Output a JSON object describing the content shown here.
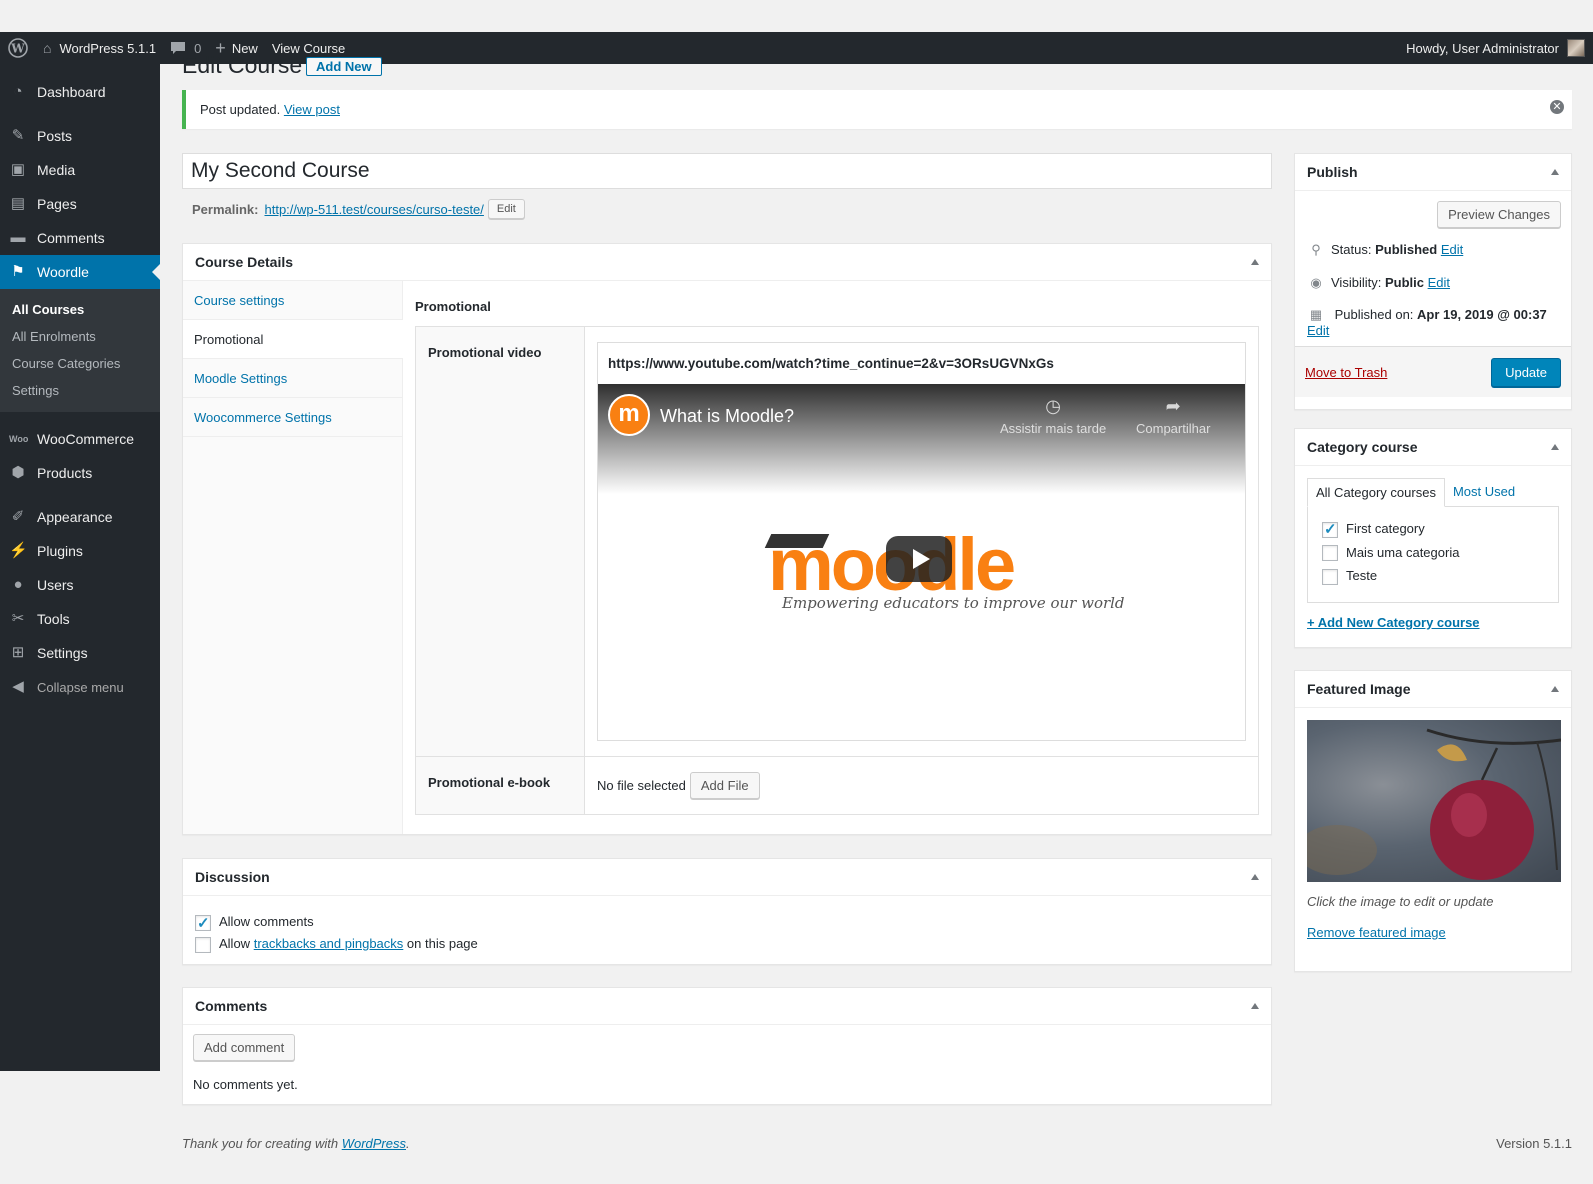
{
  "adminbar": {
    "site_name": "WordPress 5.1.1",
    "comments_count": "0",
    "new_label": "New",
    "view_label": "View Course",
    "howdy": "Howdy, User Administrator"
  },
  "sidebar": {
    "items": [
      {
        "label": "Dashboard",
        "icon": "dashboard-icon"
      },
      {
        "label": "Posts",
        "icon": "pin-icon"
      },
      {
        "label": "Media",
        "icon": "media-icon"
      },
      {
        "label": "Pages",
        "icon": "pages-icon"
      },
      {
        "label": "Comments",
        "icon": "comment-icon"
      },
      {
        "label": "Woordle",
        "icon": "graduation-cap-icon"
      }
    ],
    "submenu": [
      "All Courses",
      "All Enrolments",
      "Course Categories",
      "Settings"
    ],
    "items2": [
      {
        "label": "WooCommerce",
        "icon": "woo-icon"
      },
      {
        "label": "Products",
        "icon": "products-icon"
      }
    ],
    "items3": [
      {
        "label": "Appearance",
        "icon": "brush-icon"
      },
      {
        "label": "Plugins",
        "icon": "plugin-icon"
      },
      {
        "label": "Users",
        "icon": "user-icon"
      },
      {
        "label": "Tools",
        "icon": "wrench-icon"
      },
      {
        "label": "Settings",
        "icon": "settings-icon"
      }
    ],
    "collapse": "Collapse menu"
  },
  "page": {
    "heading": "Edit Course",
    "add_new": "Add New",
    "notice_text": "Post updated.",
    "notice_link": "View post",
    "title_value": "My Second Course",
    "permalink_label": "Permalink:",
    "permalink_url": "http://wp-511.test/courses/curso-teste/",
    "permalink_edit": "Edit"
  },
  "course_details": {
    "title": "Course Details",
    "tabs": [
      "Course settings",
      "Promotional",
      "Moodle Settings",
      "Woocommerce Settings"
    ],
    "pane_title": "Promotional",
    "video_label": "Promotional video",
    "video_url": "https://www.youtube.com/watch?time_continue=2&v=3ORsUGVNxGs",
    "video_title": "What is Moodle?",
    "watch_later": "Assistir mais tarde",
    "share": "Compartilhar",
    "moodle_logo": "moodle",
    "moodle_tagline": "Empowering educators to improve our world",
    "ebook_label": "Promotional e-book",
    "no_file": "No file selected",
    "add_file": "Add File"
  },
  "discussion": {
    "title": "Discussion",
    "allow_comments": "Allow comments",
    "allow_prefix": "Allow",
    "trackbacks_link": "trackbacks and pingbacks",
    "allow_suffix": "on this page"
  },
  "comments_box": {
    "title": "Comments",
    "add_comment": "Add comment",
    "no_comments": "No comments yet."
  },
  "publish": {
    "title": "Publish",
    "preview": "Preview Changes",
    "status_label": "Status:",
    "status_value": "Published",
    "visibility_label": "Visibility:",
    "visibility_value": "Public",
    "published_label": "Published on:",
    "published_value": "Apr 19, 2019 @ 00:37",
    "edit": "Edit",
    "trash": "Move to Trash",
    "update": "Update"
  },
  "category": {
    "title": "Category course",
    "tab_all": "All Category courses",
    "tab_used": "Most Used",
    "items": [
      {
        "label": "First category",
        "checked": true
      },
      {
        "label": "Mais uma categoria",
        "checked": false
      },
      {
        "label": "Teste",
        "checked": false
      }
    ],
    "add_new": "+ Add New Category course"
  },
  "featured": {
    "title": "Featured Image",
    "hint": "Click the image to edit or update",
    "remove": "Remove featured image"
  },
  "footer": {
    "thanks_prefix": "Thank you for creating with",
    "wp_link": "WordPress",
    "thanks_suffix": ".",
    "version": "Version 5.1.1"
  },
  "colors": {
    "adminbar_bg": "#23282d",
    "accent": "#0073aa",
    "primary_button": "#0085ba",
    "notice_success": "#46b450",
    "moodle_orange": "#f98012"
  }
}
